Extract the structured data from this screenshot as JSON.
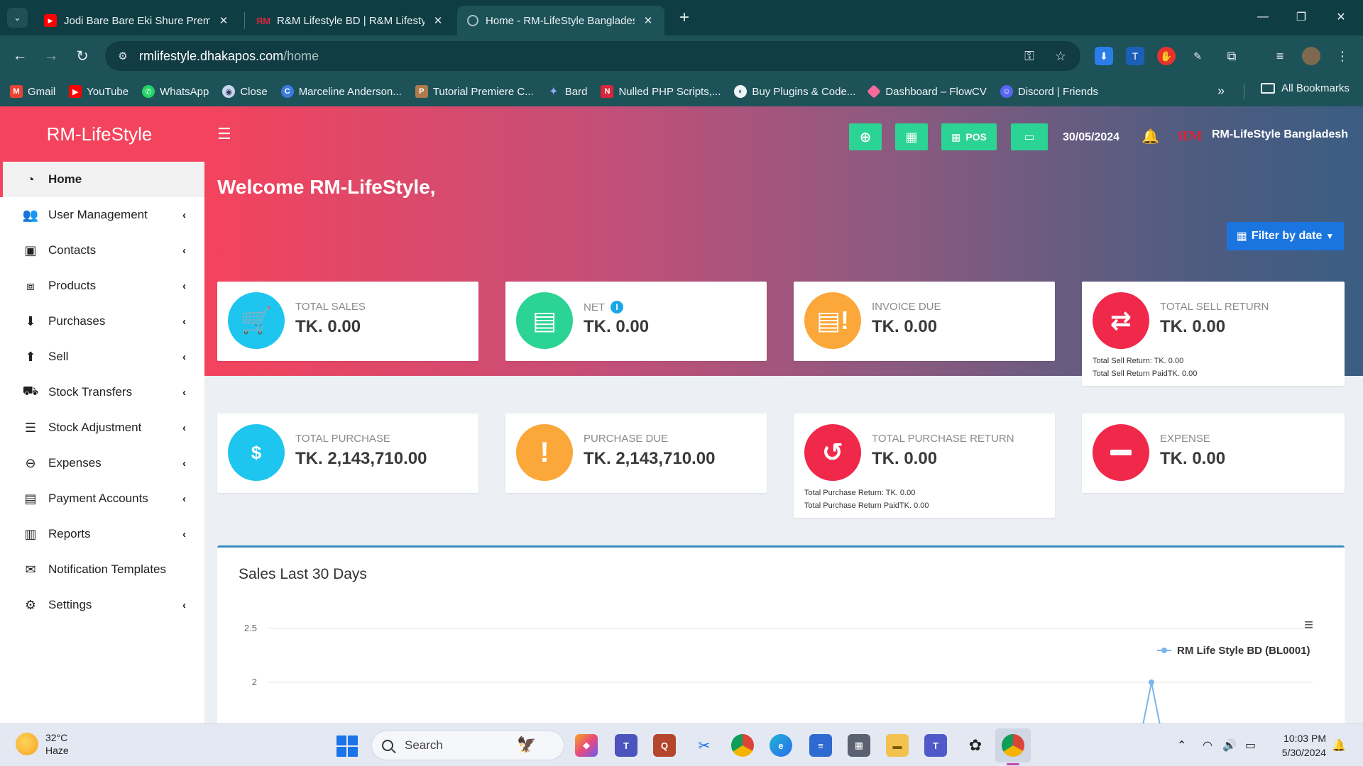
{
  "browser": {
    "tabs": [
      {
        "title": "Jodi Bare Bare Eki Shure Prem T",
        "favicon": "youtube-icon"
      },
      {
        "title": "R&M Lifestyle BD | R&M Lifesty",
        "favicon": "rm-logo-icon"
      },
      {
        "title": "Home - RM-LifeStyle Banglades",
        "favicon": "globe-icon",
        "active": true
      }
    ],
    "url_host": "rmlifestyle.dhakapos.com",
    "url_path": "/home",
    "bookmarks": [
      {
        "label": "Gmail",
        "icon": "gmail-icon",
        "color": "#ea4335"
      },
      {
        "label": "YouTube",
        "icon": "youtube-icon",
        "color": "#ff0000"
      },
      {
        "label": "WhatsApp",
        "icon": "whatsapp-icon",
        "color": "#25d366"
      },
      {
        "label": "Close",
        "icon": "close-site-icon",
        "color": "#8ab4f8"
      },
      {
        "label": "Marceline Anderson...",
        "icon": "canva-icon",
        "color": "#3b7be0"
      },
      {
        "label": "Tutorial Premiere C...",
        "icon": "premiere-icon",
        "color": "#b07a4a"
      },
      {
        "label": "Bard",
        "icon": "bard-icon",
        "color": "#7b8cf5"
      },
      {
        "label": "Nulled PHP Scripts,...",
        "icon": "nulled-icon",
        "color": "#d9263a"
      },
      {
        "label": "Buy Plugins & Code...",
        "icon": "plugins-icon",
        "color": "#444444"
      },
      {
        "label": "Dashboard – FlowCV",
        "icon": "flowcv-icon",
        "color": "#f46a9b"
      },
      {
        "label": "Discord | Friends",
        "icon": "discord-icon",
        "color": "#5865f2"
      }
    ],
    "all_bookmarks_label": "All Bookmarks"
  },
  "app": {
    "brand": "RM-LifeStyle",
    "accent_color": "#f4435d",
    "sidebar": [
      {
        "label": "Home",
        "icon": "dashboard-icon",
        "active": true,
        "has_submenu": false
      },
      {
        "label": "User Management",
        "icon": "users-icon",
        "has_submenu": true
      },
      {
        "label": "Contacts",
        "icon": "address-book-icon",
        "has_submenu": true
      },
      {
        "label": "Products",
        "icon": "cubes-icon",
        "has_submenu": true
      },
      {
        "label": "Purchases",
        "icon": "arrow-circle-down-icon",
        "has_submenu": true
      },
      {
        "label": "Sell",
        "icon": "arrow-circle-up-icon",
        "has_submenu": true
      },
      {
        "label": "Stock Transfers",
        "icon": "truck-icon",
        "has_submenu": true
      },
      {
        "label": "Stock Adjustment",
        "icon": "database-icon",
        "has_submenu": true
      },
      {
        "label": "Expenses",
        "icon": "minus-circle-icon",
        "has_submenu": true
      },
      {
        "label": "Payment Accounts",
        "icon": "money-check-icon",
        "has_submenu": true
      },
      {
        "label": "Reports",
        "icon": "bar-chart-icon",
        "has_submenu": true
      },
      {
        "label": "Notification Templates",
        "icon": "envelope-icon",
        "has_submenu": false
      },
      {
        "label": "Settings",
        "icon": "cog-icon",
        "has_submenu": true
      }
    ],
    "header": {
      "pos_label": "POS",
      "date": "30/05/2024",
      "business_name": "RM-LifeStyle Bangladesh"
    },
    "welcome": "Welcome RM-LifeStyle,",
    "filter_label": "Filter by date",
    "cards_row1": [
      {
        "label": "TOTAL SALES",
        "value": "TK. 0.00",
        "icon": "cart-icon",
        "color": "#1ec5ee"
      },
      {
        "label": "NET",
        "value": "TK. 0.00",
        "icon": "ledger-icon",
        "color": "#2bd394",
        "info": "i"
      },
      {
        "label": "INVOICE DUE",
        "value": "TK. 0.00",
        "icon": "invoice-alert-icon",
        "color": "#fba73a"
      },
      {
        "label": "TOTAL SELL RETURN",
        "value": "TK. 0.00",
        "icon": "exchange-icon",
        "color": "#f0284a",
        "notes": [
          "Total Sell Return: TK. 0.00",
          "Total Sell Return PaidTK. 0.00"
        ]
      }
    ],
    "cards_row2": [
      {
        "label": "TOTAL PURCHASE",
        "value": "TK. 2,143,710.00",
        "icon": "money-bill-icon",
        "color": "#1ec5ee"
      },
      {
        "label": "PURCHASE DUE",
        "value": "TK. 2,143,710.00",
        "icon": "exclamation-icon",
        "color": "#fba73a"
      },
      {
        "label": "TOTAL PURCHASE RETURN",
        "value": "TK. 0.00",
        "icon": "undo-icon",
        "color": "#f0284a",
        "notes": [
          "Total Purchase Return: TK. 0.00",
          "Total Purchase Return PaidTK. 0.00"
        ]
      },
      {
        "label": "EXPENSE",
        "value": "TK. 0.00",
        "icon": "minus-circle-icon",
        "color": "#f0284a"
      }
    ],
    "chart_title": "Sales Last 30 Days"
  },
  "chart_data": {
    "type": "line",
    "title": "Sales Last 30 Days",
    "y_ticks": [
      "2.5",
      "2"
    ],
    "series": [
      {
        "name": "RM Life Style BD (BL0001)",
        "color": "#7cb5ec"
      }
    ],
    "legend_position": "top-right",
    "note": "chart is cut off by the viewport; only the upper gridlines and a single spike reaching 2 are visible"
  },
  "taskbar": {
    "temperature": "32°C",
    "condition": "Haze",
    "search_placeholder": "Search",
    "time": "10:03 PM",
    "date": "5/30/2024"
  }
}
